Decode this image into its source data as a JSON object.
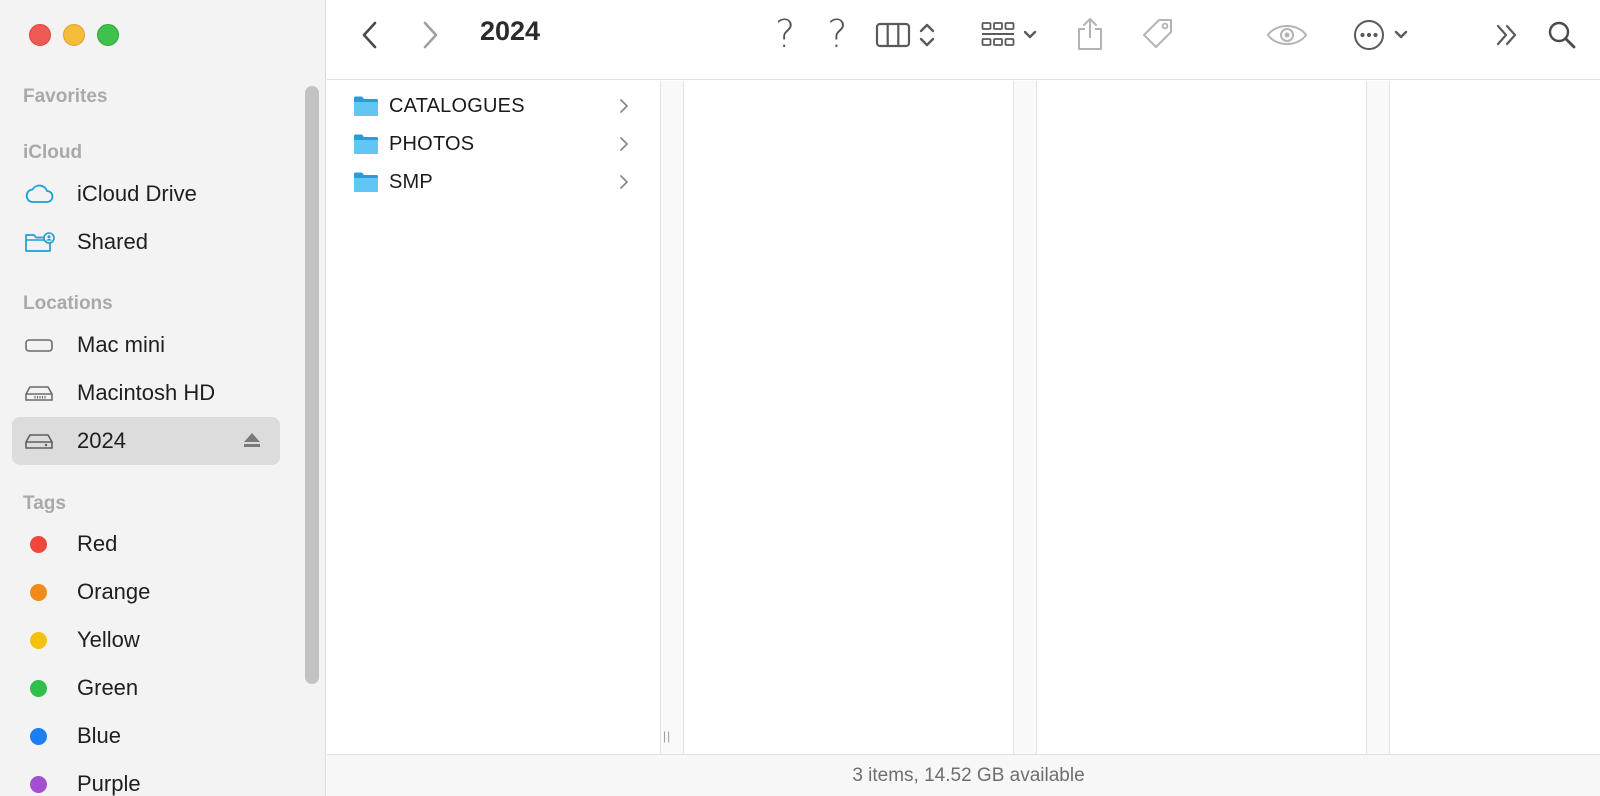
{
  "window": {
    "title": "2024"
  },
  "sidebar": {
    "sections": {
      "favorites": "Favorites",
      "icloud": "iCloud",
      "locations": "Locations",
      "tags": "Tags"
    },
    "icloud_items": [
      {
        "label": "iCloud Drive",
        "icon": "cloud-icon"
      },
      {
        "label": "Shared",
        "icon": "shared-folder-icon"
      }
    ],
    "location_items": [
      {
        "label": "Mac mini",
        "icon": "computer-icon"
      },
      {
        "label": "Macintosh HD",
        "icon": "hard-drive-icon"
      },
      {
        "label": "2024",
        "icon": "external-drive-icon",
        "selected": true
      }
    ],
    "tag_items": [
      {
        "label": "Red",
        "color": "#f0463c"
      },
      {
        "label": "Orange",
        "color": "#f28a1b"
      },
      {
        "label": "Yellow",
        "color": "#f4c20d"
      },
      {
        "label": "Green",
        "color": "#2ec04a"
      },
      {
        "label": "Blue",
        "color": "#1a7ef5"
      },
      {
        "label": "Purple",
        "color": "#a24fd0"
      }
    ]
  },
  "toolbar": {
    "back_icon": "chevron-left-icon",
    "forward_icon": "chevron-right-icon",
    "placeholder_marks": "? ?",
    "view_icon": "column-view-icon",
    "group_icon": "group-grid-icon",
    "share_icon": "share-icon",
    "tag_icon": "tag-icon",
    "quicklook_icon": "eye-icon",
    "more_icon": "ellipsis-circle-icon",
    "overflow_icon": "double-chevron-icon",
    "search_icon": "search-icon"
  },
  "browser": {
    "items": [
      {
        "name": "CATALOGUES",
        "icon": "folder-icon"
      },
      {
        "name": "PHOTOS",
        "icon": "folder-icon"
      },
      {
        "name": "SMP",
        "icon": "folder-icon"
      }
    ],
    "grip": "||"
  },
  "status": {
    "text": "3 items, 14.52 GB available"
  },
  "colors": {
    "accent": "#1a9fd6",
    "folder": "#5ac8f5",
    "selection": "#dcdcdc"
  }
}
